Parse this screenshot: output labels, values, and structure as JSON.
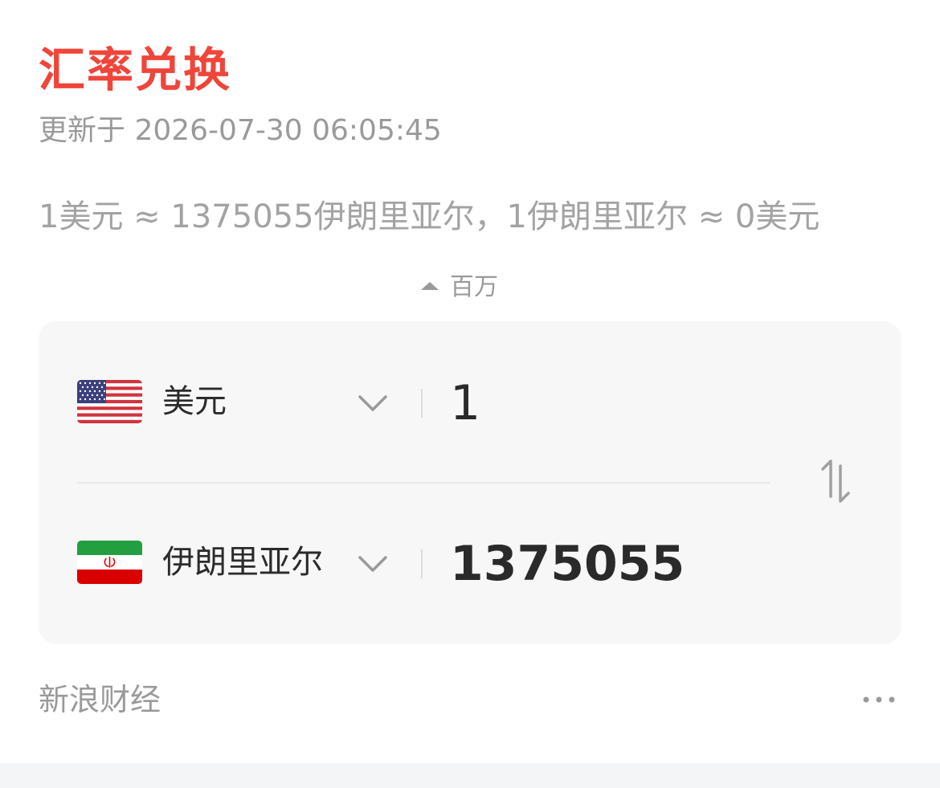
{
  "header": {
    "title": "汇率兑换",
    "updated": "更新于 2026-07-30 06:05:45"
  },
  "rate_text": "1美元 ≈ 1375055伊朗里亚尔，1伊朗里亚尔 ≈ 0美元",
  "converter": {
    "from": {
      "currency": "美元",
      "flag": "us-flag",
      "amount": "1"
    },
    "to": {
      "currency": "伊朗里亚尔",
      "flag": "iran-flag",
      "amount": "1375055"
    },
    "unit_hint": "百万"
  },
  "footer": {
    "source": "新浪财经",
    "more_icon": "more-dots-icon"
  },
  "colors": {
    "accent": "#f0453a",
    "muted": "#9a9a9a",
    "panel_bg": "#f7f7f7"
  }
}
